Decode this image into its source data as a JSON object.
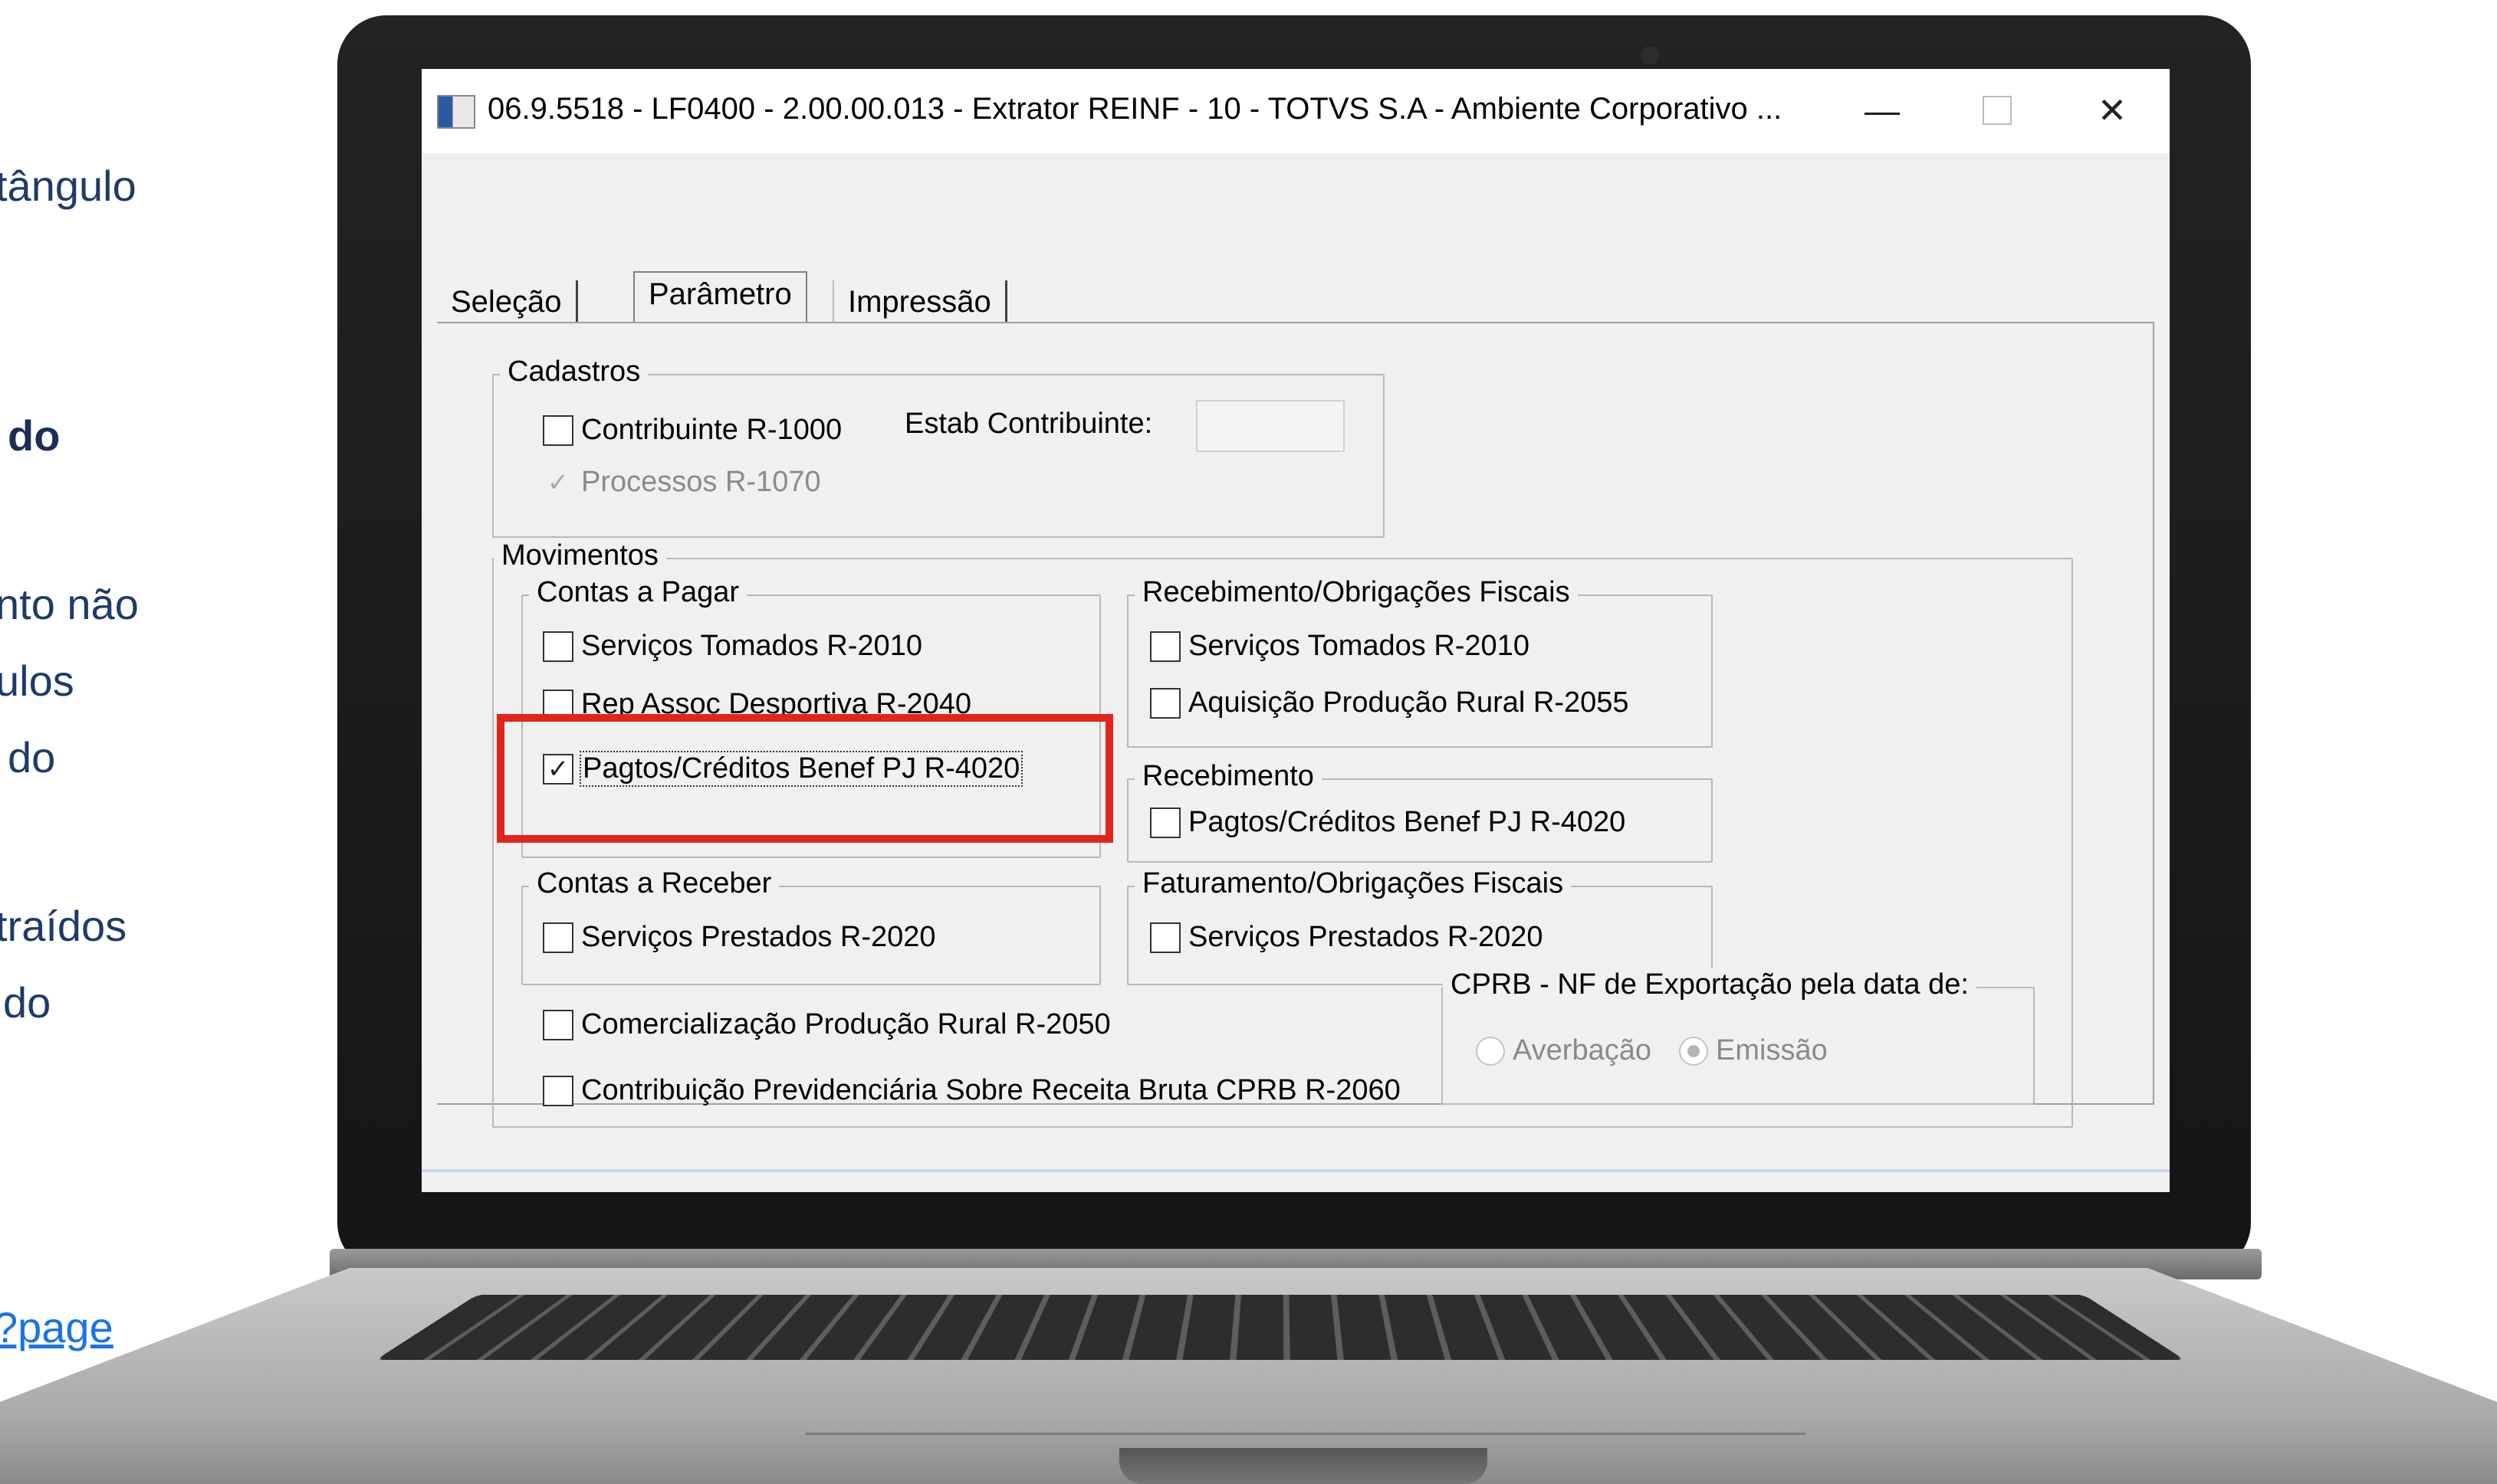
{
  "slide": {
    "line1": "tângulo",
    "line2": "do",
    "line3": "nto não",
    "line4": "ulos",
    "line5": "do",
    "line6": "traídos",
    "line7": "do",
    "link": "?page"
  },
  "window": {
    "title": "06.9.5518 - LF0400 - 2.00.00.013 - Extrator REINF - 10 - TOTVS S.A - Ambiente Corporativo ...",
    "minimize": "—",
    "close": "✕"
  },
  "tabs": [
    "Seleção",
    "Parâmetro",
    "Impressão"
  ],
  "cadastros": {
    "legend": "Cadastros",
    "contribuinte": "Contribuinte R-1000",
    "contribuinte_checked": false,
    "estab_label": "Estab Contribuinte:",
    "estab_value": "",
    "processos": "Processos R-1070",
    "processos_checked": true
  },
  "movimentos": {
    "legend": "Movimentos",
    "contas_pagar": {
      "legend": "Contas a Pagar",
      "servicos_tomados": "Serviços Tomados R-2010",
      "rep_assoc": "Rep Assoc Desportiva R-2040",
      "pagtos": "Pagtos/Créditos Benef PJ R-4020",
      "pagtos_checked": true
    },
    "receb_obrig": {
      "legend": "Recebimento/Obrigações Fiscais",
      "servicos_tomados": "Serviços Tomados R-2010",
      "aquisicao": "Aquisição Produção Rural R-2055"
    },
    "recebimento": {
      "legend": "Recebimento",
      "pagtos": "Pagtos/Créditos Benef PJ R-4020"
    },
    "contas_receber": {
      "legend": "Contas a Receber",
      "servicos_prestados": "Serviços Prestados R-2020"
    },
    "fat_obrig": {
      "legend": "Faturamento/Obrigações Fiscais",
      "servicos_prestados": "Serviços Prestados R-2020"
    },
    "comercializacao": "Comercialização Produção Rural R-2050",
    "cprb": "Contribuição Previdenciária Sobre Receita Bruta CPRB R-2060",
    "cprb_export": {
      "legend": "CPRB - NF de Exportação pela data de:",
      "averbacao": "Averbação",
      "emissao": "Emissão",
      "selected": "Emissão"
    }
  },
  "colors": {
    "highlight": "#e1251b",
    "slide_text": "#1f3a6b",
    "link": "#1a73e8"
  }
}
